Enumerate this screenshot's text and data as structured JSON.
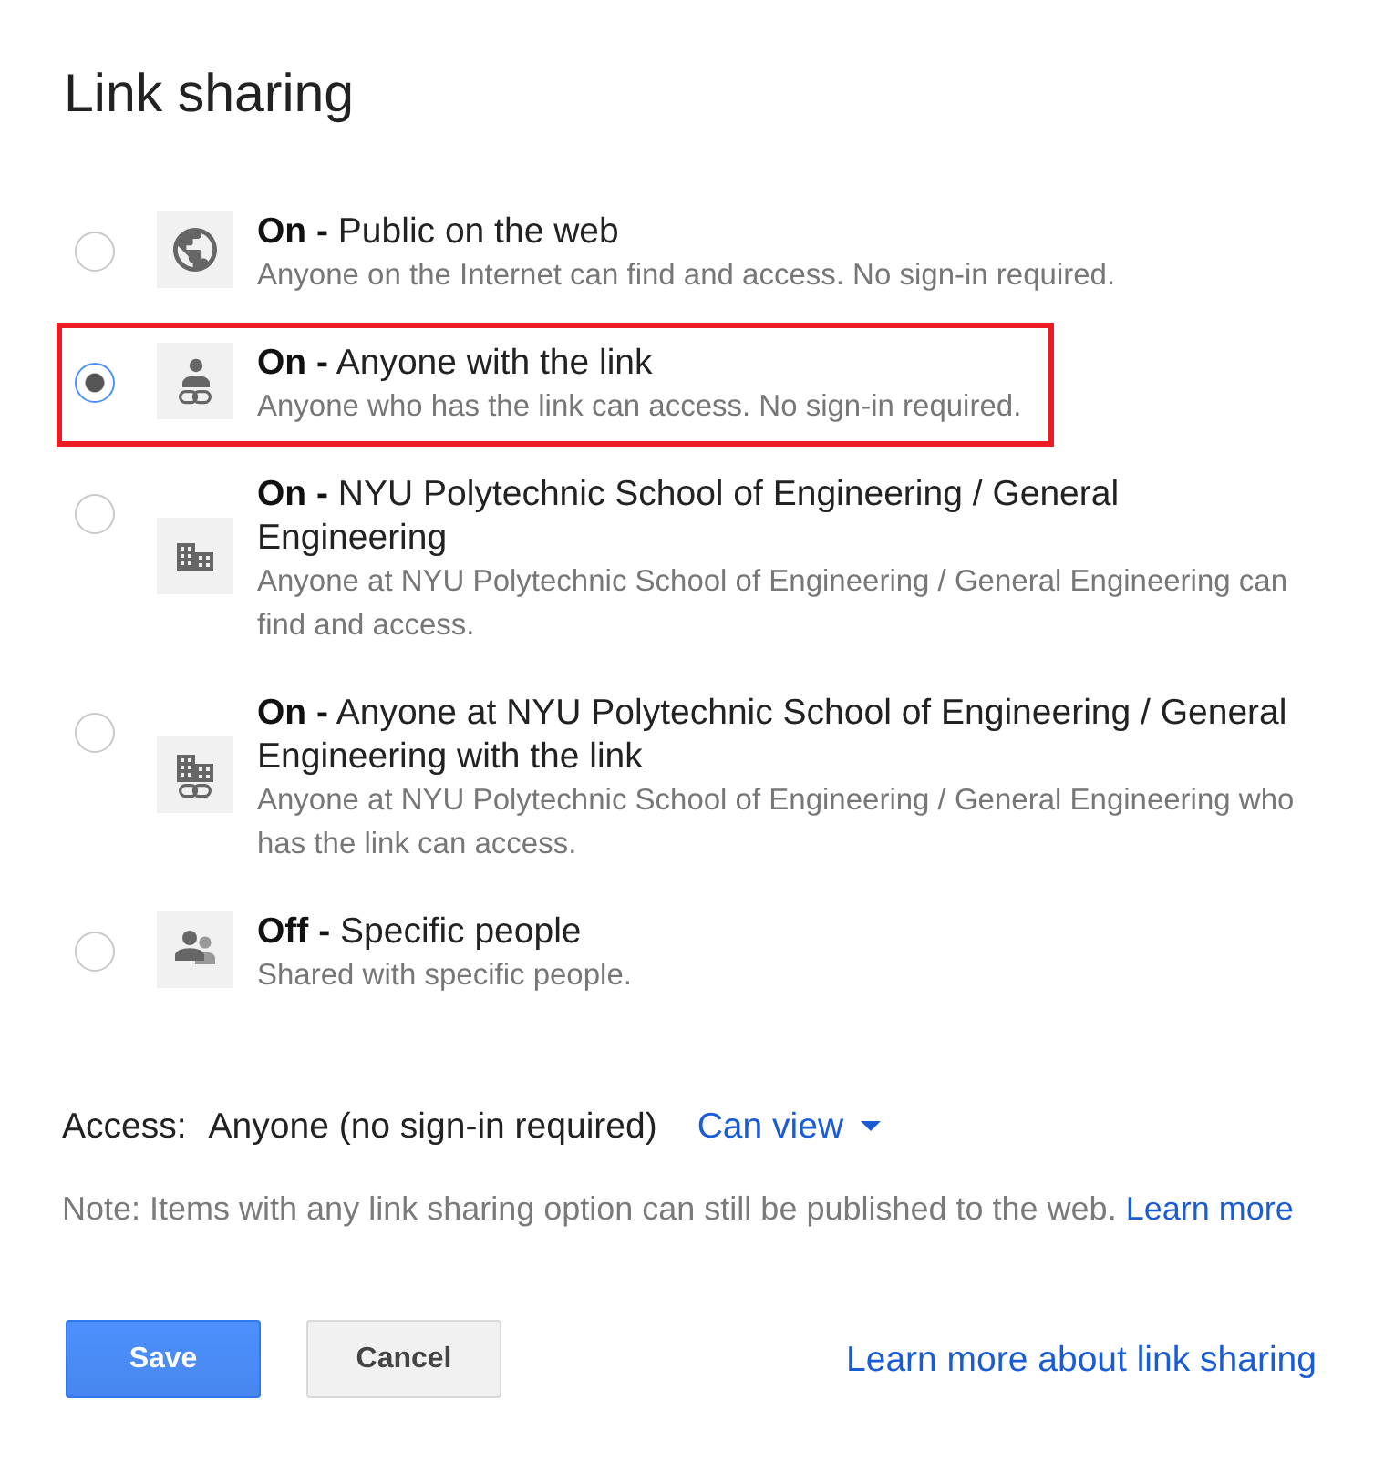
{
  "dialog": {
    "title": "Link sharing"
  },
  "options": [
    {
      "kind": "web",
      "title": "**On -** Public on the web",
      "description": "Anyone on the Internet can find and access. No sign-in required.",
      "selected": false,
      "highlighted": false
    },
    {
      "kind": "link",
      "title": "**On -** Anyone with the link",
      "description": "Anyone who has the link can access. No sign-in required.",
      "selected": true,
      "highlighted": true
    },
    {
      "kind": "domain",
      "title": "**On -** NYU Polytechnic School of Engineering / General Engineering",
      "description": "Anyone at NYU Polytechnic School of Engineering / General Engineering can find and access.",
      "selected": false,
      "highlighted": false
    },
    {
      "kind": "domain-link",
      "title": "**On -** Anyone at NYU Polytechnic School of Engineering / General Engineering with the link",
      "description": "Anyone at NYU Polytechnic School of Engineering / General Engineering who has the link can access.",
      "selected": false,
      "highlighted": false
    },
    {
      "kind": "people",
      "title": "**Off -** Specific people",
      "description": "Shared with specific people.",
      "selected": false,
      "highlighted": false
    }
  ],
  "access": {
    "label": "Access:",
    "value": "Anyone (no sign-in required)",
    "permission": "Can view"
  },
  "note": {
    "text": "Note: Items with any link sharing option can still be published to the web.",
    "link": "Learn more"
  },
  "buttons": [
    {
      "kind": "primary",
      "label": "Save"
    },
    {
      "kind": "secondary",
      "label": "Cancel"
    }
  ],
  "help_link": "Learn more about link sharing"
}
